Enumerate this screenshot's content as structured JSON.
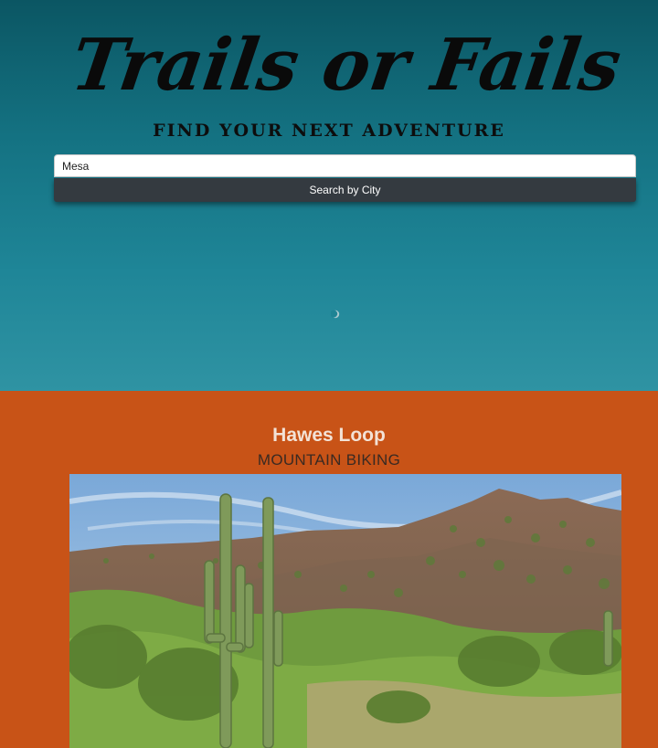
{
  "header": {
    "logo_text": "Trails or Fails",
    "tagline": "FIND YOUR NEXT ADVENTURE"
  },
  "search": {
    "value": "Mesa",
    "button_label": "Search by City"
  },
  "result": {
    "trail_name": "Hawes Loop",
    "activity": "MOUNTAIN BIKING"
  },
  "colors": {
    "sky_top": "#0b5663",
    "sky_bottom": "#2f93a3",
    "results_bg": "#c85317",
    "button_bg": "#343a40"
  }
}
